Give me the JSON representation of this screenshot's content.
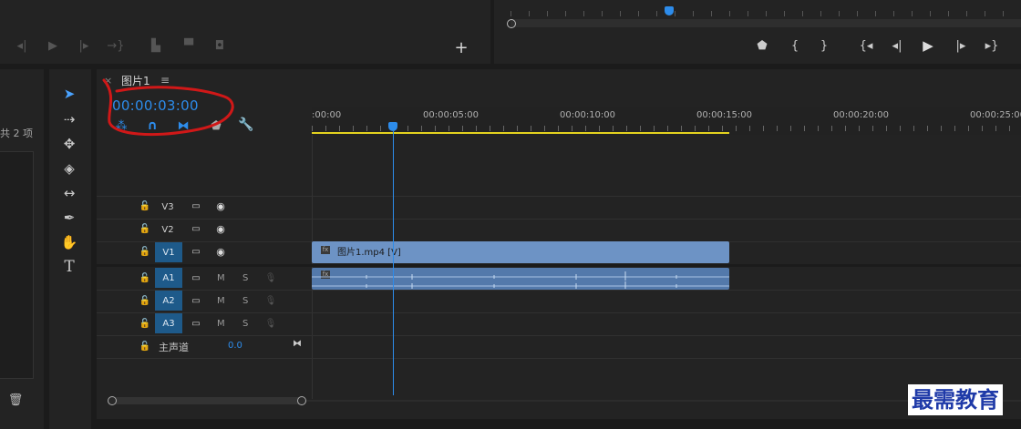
{
  "timeline": {
    "tab_close": "×",
    "tab_title": "图片1",
    "tab_menu": "≡",
    "timecode": "00:00:03:00",
    "ruler_labels": [
      ":00:00",
      "00:00:05:00",
      "00:00:10:00",
      "00:00:15:00",
      "00:00:20:00",
      "00:00:25:00"
    ]
  },
  "project_panel": {
    "item_count": "共 2 项"
  },
  "tracks": {
    "video": [
      {
        "name": "V3"
      },
      {
        "name": "V2"
      },
      {
        "name": "V1"
      }
    ],
    "audio": [
      {
        "name": "A1",
        "mute": "M",
        "solo": "S"
      },
      {
        "name": "A2",
        "mute": "M",
        "solo": "S"
      },
      {
        "name": "A3",
        "mute": "M",
        "solo": "S"
      }
    ],
    "master": {
      "label": "主声道",
      "value": "0.0"
    }
  },
  "clips": {
    "video_clip": "图片1.mp4 [V]"
  },
  "colors": {
    "accent": "#2d8ceb",
    "clip_video": "#6d93c5",
    "clip_audio": "#5379ab",
    "workarea": "#e3d21f",
    "annotation": "#d01818"
  },
  "icons": {
    "top_left_controls": [
      "step-back-icon",
      "play-icon",
      "step-forward-icon",
      "insert-icon",
      "lift-icon",
      "extract-icon",
      "camera-icon"
    ],
    "program_controls": [
      "marker-icon",
      "in-point-icon",
      "out-point-icon",
      "go-to-in-icon",
      "step-back-icon",
      "play-icon",
      "step-forward-icon",
      "go-to-out-icon"
    ]
  },
  "watermark": "最需教育"
}
